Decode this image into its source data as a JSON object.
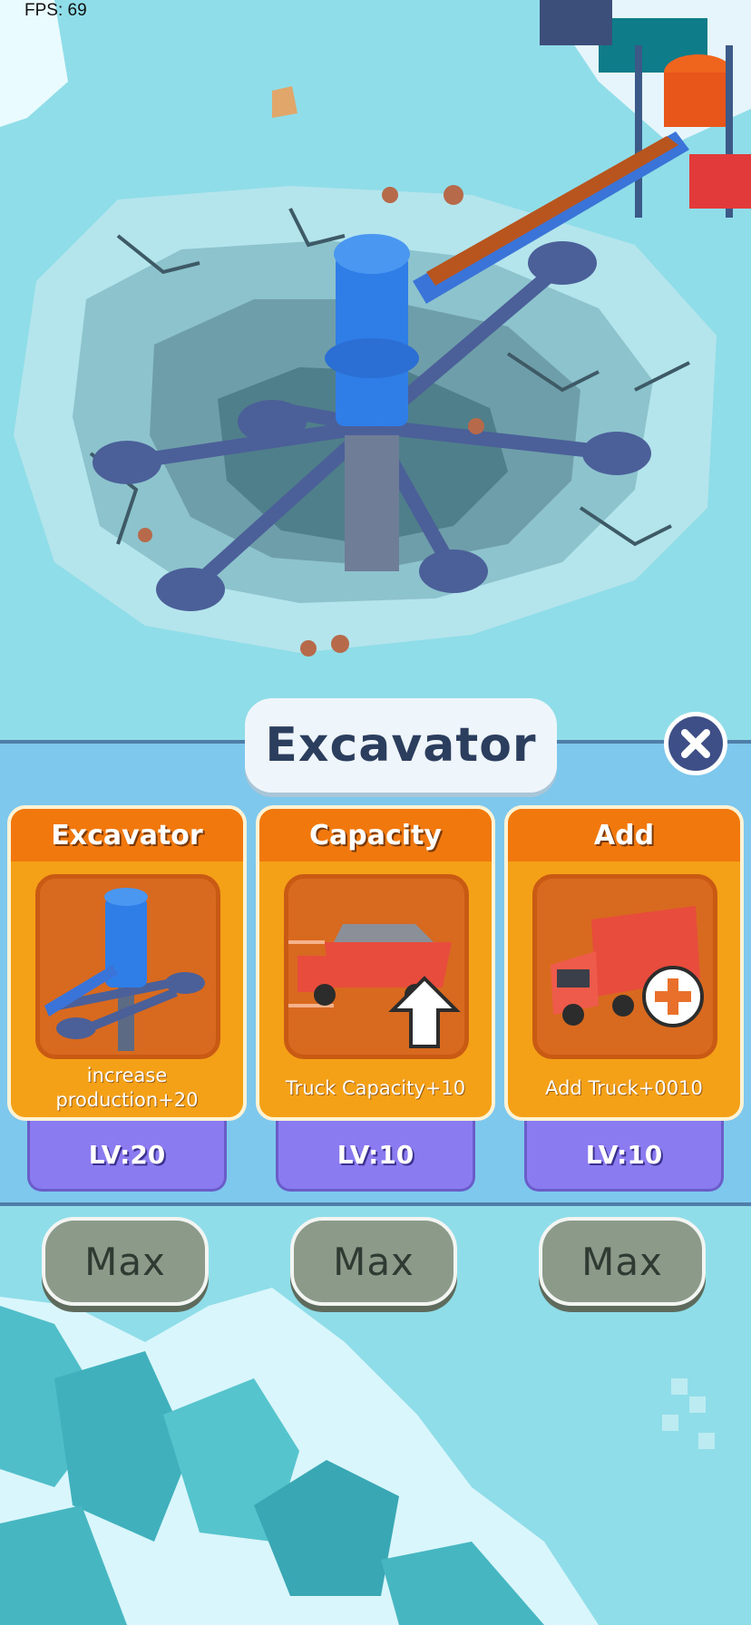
{
  "hud": {
    "fps": "FPS: 69"
  },
  "panel": {
    "title": "Excavator",
    "cards": [
      {
        "title": "Excavator",
        "desc": "increase\nproduction+20",
        "level": "LV:20",
        "button": "Max",
        "icon": "excavator-tower-icon"
      },
      {
        "title": "Capacity",
        "desc": "Truck Capacity+10",
        "level": "LV:10",
        "button": "Max",
        "icon": "truck-capacity-icon"
      },
      {
        "title": "Add",
        "desc": "Add Truck+0010",
        "level": "LV:10",
        "button": "Max",
        "icon": "add-truck-icon"
      }
    ]
  },
  "colors": {
    "water": "#8fdde8",
    "panel": "#7ec8ee",
    "card": "#f4a118",
    "card_header": "#f0780d",
    "level_badge": "#8a7cf0",
    "max_button": "#8c9a8a"
  }
}
